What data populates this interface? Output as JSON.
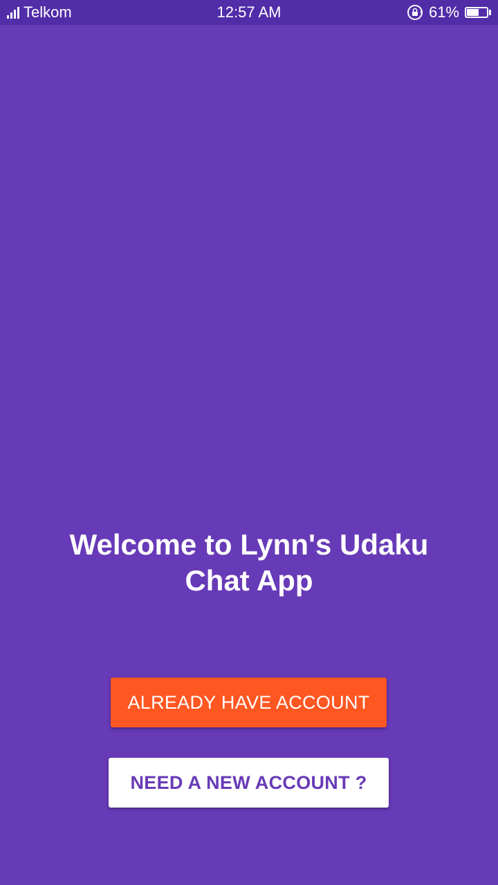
{
  "status_bar": {
    "carrier": "Telkom",
    "time": "12:57 AM",
    "battery_percent_label": "61%",
    "battery_level": 0.61,
    "icons": [
      "signal-icon",
      "rotation-lock-icon",
      "battery-icon"
    ]
  },
  "welcome": {
    "title": "Welcome to Lynn's Udaku Chat App"
  },
  "buttons": {
    "login_label": "ALREADY HAVE ACCOUNT",
    "register_label": "NEED A NEW ACCOUNT ?"
  },
  "colors": {
    "background": "#673AB7",
    "status_bar": "#512DA8",
    "accent": "#FF5722",
    "on_accent": "#FFFFFF",
    "secondary_button_bg": "#FFFFFF",
    "secondary_button_text": "#673AB7"
  }
}
